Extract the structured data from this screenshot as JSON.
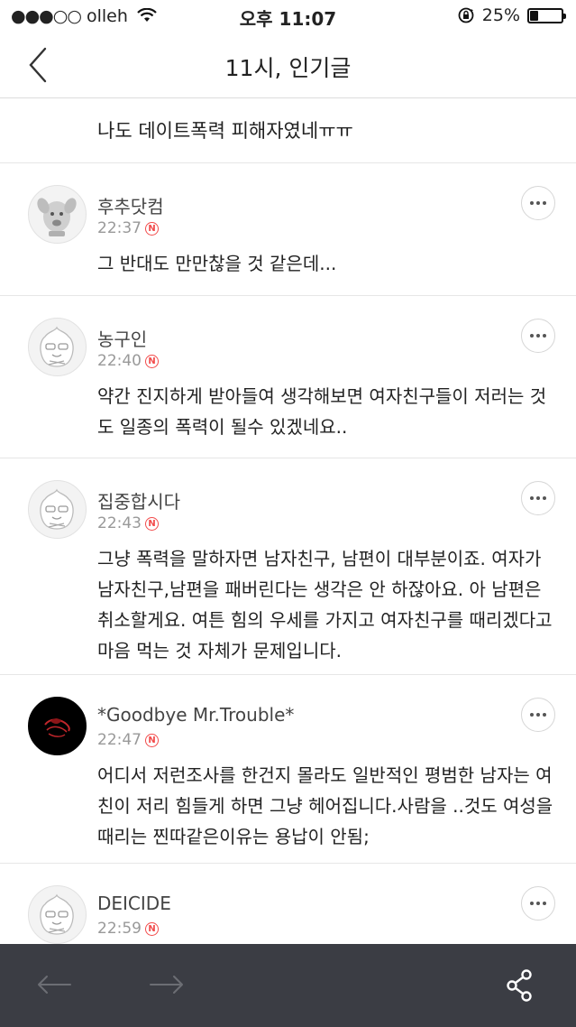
{
  "status_bar": {
    "signal_dots": "●●●○○",
    "carrier": "olleh",
    "time": "오후 11:07",
    "battery_percent": "25%",
    "battery_level": 0.25
  },
  "nav": {
    "title": "11시, 인기글",
    "back_icon": "chevron-left-icon"
  },
  "headline": {
    "text": "나도 데이트폭력 피해자였네ㅠㅠ"
  },
  "comments": [
    {
      "author": "후추닷컴",
      "time": "22:37",
      "badge": "N",
      "body": "그 반대도 만만찮을 것 같은데...",
      "avatar": "dog-avatar-icon"
    },
    {
      "author": "농구인",
      "time": "22:40",
      "badge": "N",
      "body": "약간 진지하게 받아들여 생각해보면 여자친구들이 저러는 것도 일종의 폭력이 될수 있겠네요..",
      "avatar": "default-avatar-icon"
    },
    {
      "author": "집중합시다",
      "time": "22:43",
      "badge": "N",
      "body": "그냥 폭력을 말하자면 남자친구, 남편이 대부분이죠. 여자가 남자친구,남편을 패버린다는 생각은 안 하잖아요. 아 남편은 취소할게요. 여튼 힘의 우세를 가지고 여자친구를 때리겠다고 마음 먹는 것 자체가 문제입니다.",
      "avatar": "default-avatar-icon"
    },
    {
      "author": "*Goodbye Mr.Trouble*",
      "time": "22:47",
      "badge": "N",
      "body": "어디서 저런조사를 한건지 몰라도 일반적인 평범한 남자는 여친이 저리 힘들게 하면 그냥 헤어집니다.사람을 ..것도 여성을 때리는 찐따같은이유는 용납이 안됨;",
      "avatar": "dark-emblem-avatar-icon"
    },
    {
      "author": "DEICIDE",
      "time": "22:59",
      "badge": "N",
      "body": "",
      "avatar": "default-avatar-icon"
    }
  ],
  "bottom_bar": {
    "back_icon": "arrow-left-icon",
    "forward_icon": "arrow-right-icon",
    "share_icon": "share-icon"
  },
  "colors": {
    "badge_red": "#f24b4b",
    "bottom_bar_bg": "#3b3d44",
    "divider": "#e6e6e6"
  }
}
